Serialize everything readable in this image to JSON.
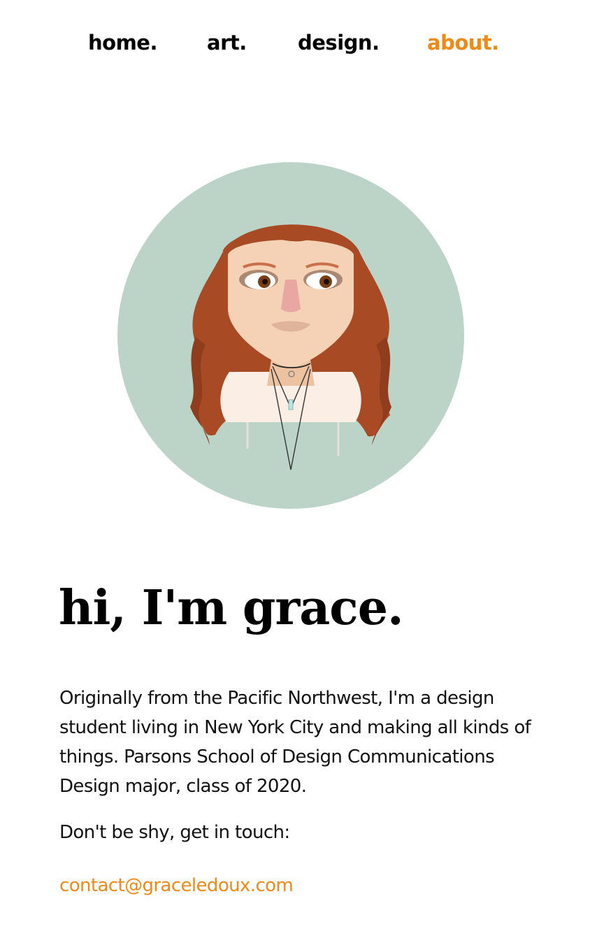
{
  "nav": {
    "items": [
      {
        "label": "home.",
        "active": false
      },
      {
        "label": "art.",
        "active": false
      },
      {
        "label": "design.",
        "active": false
      },
      {
        "label": "about.",
        "active": true
      }
    ]
  },
  "avatar": {
    "icon": "portrait-illustration",
    "background_color": "#bcd4c8",
    "hair_color": "#a84b25",
    "skin_color": "#f5d2b5"
  },
  "main": {
    "heading": "hi, I'm grace.",
    "bio": "Originally from the Pacific Northwest, I'm a design student living in New York City and making all kinds of things. Parsons School of Design Communications Design major, class of 2020.",
    "cta": "Don't be shy, get in touch:",
    "email": "contact@graceledoux.com"
  },
  "colors": {
    "accent": "#ee8a16",
    "text": "#000000"
  }
}
